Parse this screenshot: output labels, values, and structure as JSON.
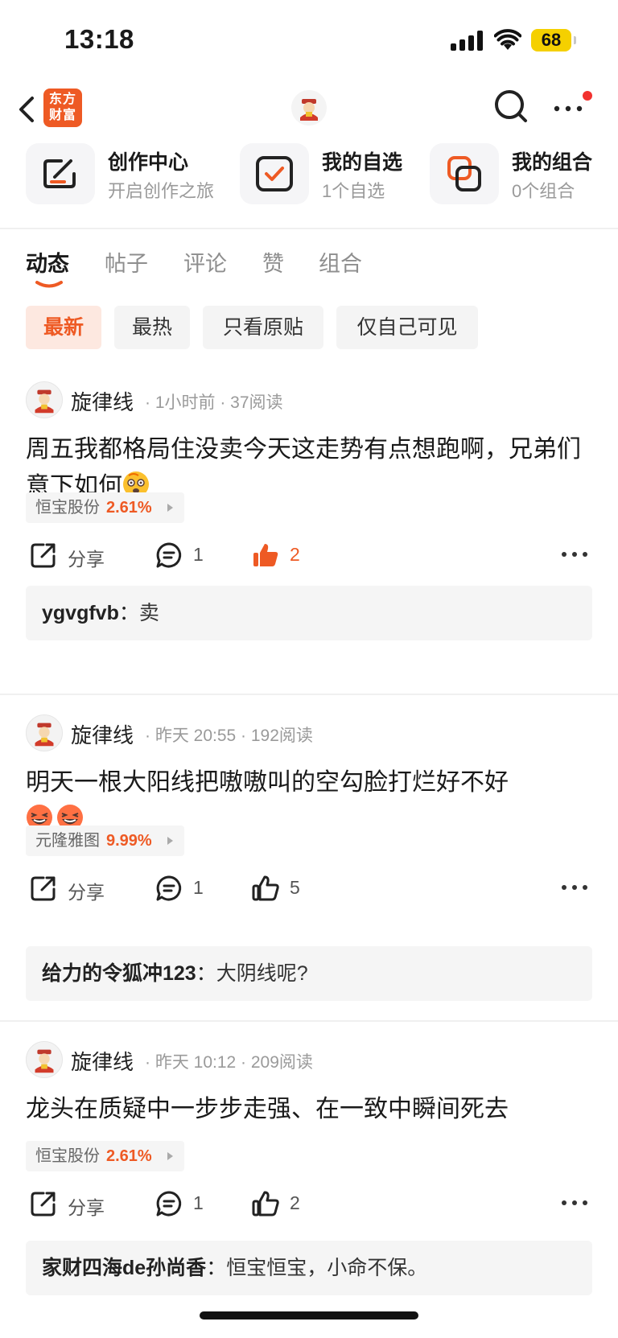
{
  "status_bar": {
    "time": "13:18",
    "battery": "68"
  },
  "nav": {
    "brand_line1": "东方",
    "brand_line2": "财富"
  },
  "tiles": [
    {
      "title": "创作中心",
      "subtitle": "开启创作之旅"
    },
    {
      "title": "我的自选",
      "subtitle": "1个自选"
    },
    {
      "title": "我的组合",
      "subtitle": "0个组合"
    }
  ],
  "tabs": [
    {
      "label": "动态"
    },
    {
      "label": "帖子"
    },
    {
      "label": "评论"
    },
    {
      "label": "赞"
    },
    {
      "label": "组合"
    }
  ],
  "filters": [
    {
      "label": "最新"
    },
    {
      "label": "最热"
    },
    {
      "label": "只看原贴"
    },
    {
      "label": "仅自己可见"
    }
  ],
  "labels": {
    "share": "分享"
  },
  "colors": {
    "accent": "#ee5a24",
    "badge_red": "#f2322f",
    "battery": "#f5d000"
  },
  "posts": [
    {
      "author": "旋律线",
      "meta": "· 1小时前 · 37阅读",
      "content": "周五我都格局住没卖今天这走势有点想跑啊，兄弟们意下如何",
      "stock_name": "恒宝股份",
      "stock_pct": "2.61%",
      "comments": "1",
      "likes": "2",
      "liked": true,
      "reply_user": "ygvgfvb",
      "reply_sep": "：",
      "reply_text": "卖"
    },
    {
      "author": "旋律线",
      "meta": "· 昨天 20:55 · 192阅读",
      "content": "明天一根大阳线把嗷嗷叫的空勾脸打烂好不好",
      "stock_name": "元隆雅图",
      "stock_pct": "9.99%",
      "comments": "1",
      "likes": "5",
      "liked": false,
      "reply_user": "给力的令狐冲123",
      "reply_sep": "：",
      "reply_text": "大阴线呢?"
    },
    {
      "author": "旋律线",
      "meta": "· 昨天 10:12 · 209阅读",
      "content": "龙头在质疑中一步步走强、在一致中瞬间死去",
      "stock_name": "恒宝股份",
      "stock_pct": "2.61%",
      "comments": "1",
      "likes": "2",
      "liked": false,
      "reply_user": "家财四海de孙尚香",
      "reply_sep": "：",
      "reply_text": "恒宝恒宝，小命不保。"
    }
  ]
}
